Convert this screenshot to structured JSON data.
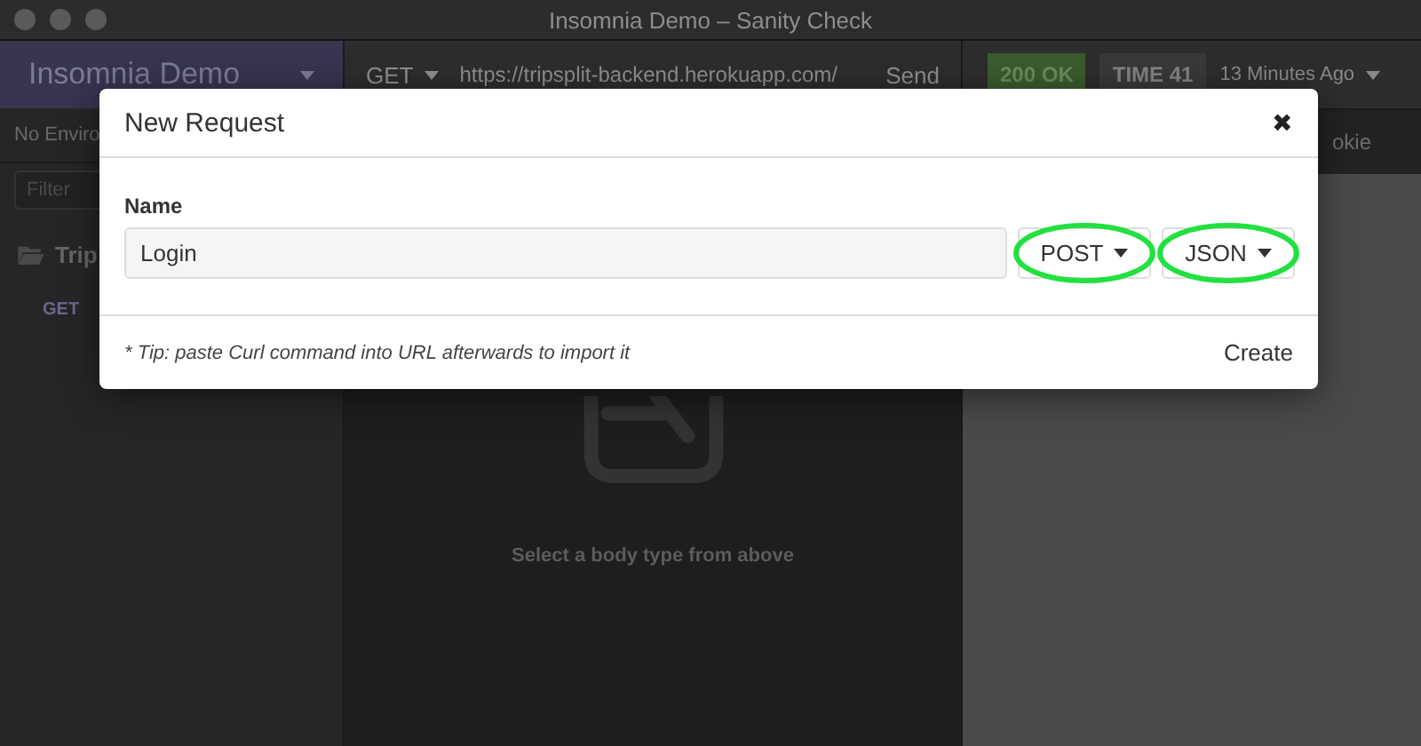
{
  "window": {
    "title": "Insomnia Demo – Sanity Check"
  },
  "sidebar": {
    "workspace": "Insomnia Demo",
    "environment": "No Enviro",
    "filter_placeholder": "Filter",
    "folder": "Trip",
    "requests": [
      {
        "method": "GET"
      }
    ]
  },
  "request_bar": {
    "method": "GET",
    "url": "https://tripsplit-backend.herokuapp.com/",
    "send": "Send"
  },
  "response": {
    "status": "200 OK",
    "time": "TIME 41",
    "age": "13 Minutes Ago",
    "tabs": [
      {
        "label": "okie"
      }
    ]
  },
  "body": {
    "message": "Select a body type from above"
  },
  "modal": {
    "title": "New Request",
    "close": "✖",
    "name_label": "Name",
    "name_value": "Login",
    "method": "POST",
    "body_type": "JSON",
    "tip": "* Tip: paste Curl command into URL afterwards to import it",
    "create": "Create"
  }
}
